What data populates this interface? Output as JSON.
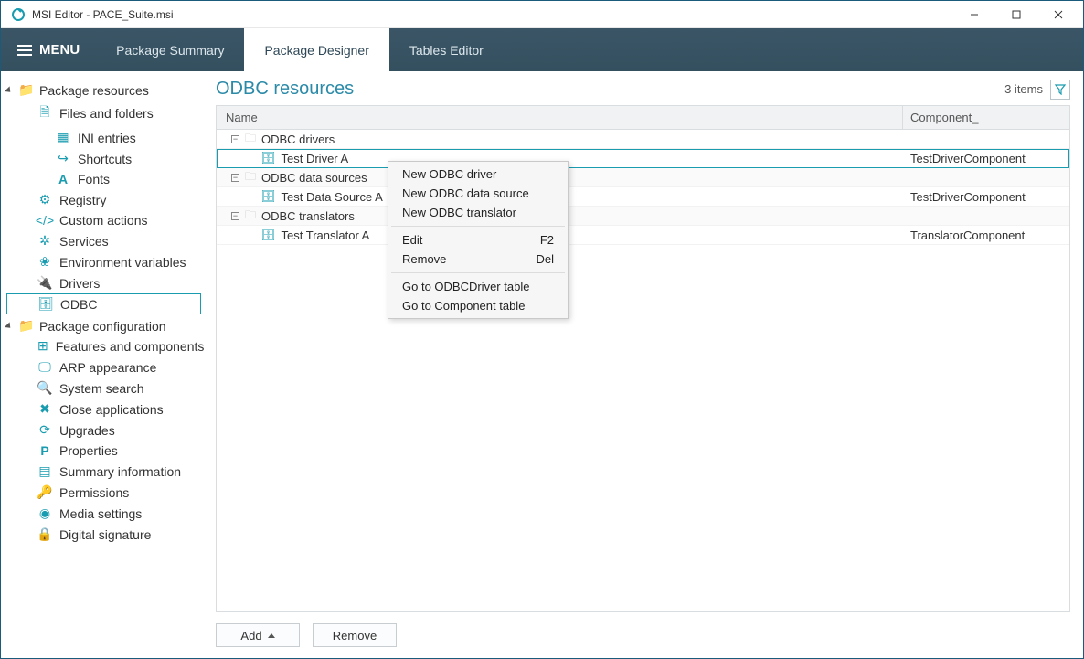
{
  "window": {
    "title": "MSI Editor - PACE_Suite.msi"
  },
  "menubar": {
    "menu_label": "MENU",
    "tabs": [
      "Package Summary",
      "Package Designer",
      "Tables Editor"
    ],
    "active": 1
  },
  "sidebar": {
    "sections": [
      {
        "label": "Package resources",
        "items": [
          {
            "label": "Files and folders",
            "icon": "file-icon",
            "children": [
              {
                "label": "INI entries",
                "icon": "ini-icon"
              },
              {
                "label": "Shortcuts",
                "icon": "shortcut-icon"
              },
              {
                "label": "Fonts",
                "icon": "font-icon"
              }
            ]
          },
          {
            "label": "Registry",
            "icon": "registry-icon"
          },
          {
            "label": "Custom actions",
            "icon": "code-icon"
          },
          {
            "label": "Services",
            "icon": "gear-icon"
          },
          {
            "label": "Environment variables",
            "icon": "leaf-icon"
          },
          {
            "label": "Drivers",
            "icon": "plug-icon"
          },
          {
            "label": "ODBC",
            "icon": "db-icon",
            "selected": true
          }
        ]
      },
      {
        "label": "Package configuration",
        "items": [
          {
            "label": "Features and components",
            "icon": "puzzle-icon"
          },
          {
            "label": "ARP appearance",
            "icon": "monitor-icon"
          },
          {
            "label": "System search",
            "icon": "search-icon"
          },
          {
            "label": "Close applications",
            "icon": "close-app-icon"
          },
          {
            "label": "Upgrades",
            "icon": "refresh-icon"
          },
          {
            "label": "Properties",
            "icon": "p-icon"
          },
          {
            "label": "Summary information",
            "icon": "summary-icon"
          },
          {
            "label": "Permissions",
            "icon": "key-icon"
          },
          {
            "label": "Media settings",
            "icon": "disc-icon"
          },
          {
            "label": "Digital signature",
            "icon": "lock-icon"
          }
        ]
      }
    ]
  },
  "main": {
    "title": "ODBC resources",
    "count_label": "3 items",
    "columns": {
      "name": "Name",
      "component": "Component_"
    },
    "groups": [
      {
        "label": "ODBC drivers",
        "rows": [
          {
            "name": "Test Driver A",
            "component": "TestDriverComponent",
            "selected": true
          }
        ]
      },
      {
        "label": "ODBC data sources",
        "rows": [
          {
            "name": "Test Data Source A",
            "component": "TestDriverComponent"
          }
        ]
      },
      {
        "label": "ODBC translators",
        "rows": [
          {
            "name": "Test Translator A",
            "component": "TranslatorComponent"
          }
        ]
      }
    ],
    "buttons": {
      "add": "Add",
      "remove": "Remove"
    }
  },
  "context_menu": {
    "items": [
      {
        "label": "New ODBC driver"
      },
      {
        "label": "New ODBC data source"
      },
      {
        "label": "New ODBC translator"
      },
      {
        "sep": true
      },
      {
        "label": "Edit",
        "shortcut": "F2"
      },
      {
        "label": "Remove",
        "shortcut": "Del"
      },
      {
        "sep": true
      },
      {
        "label": "Go to ODBCDriver table"
      },
      {
        "label": "Go to Component table"
      }
    ]
  }
}
